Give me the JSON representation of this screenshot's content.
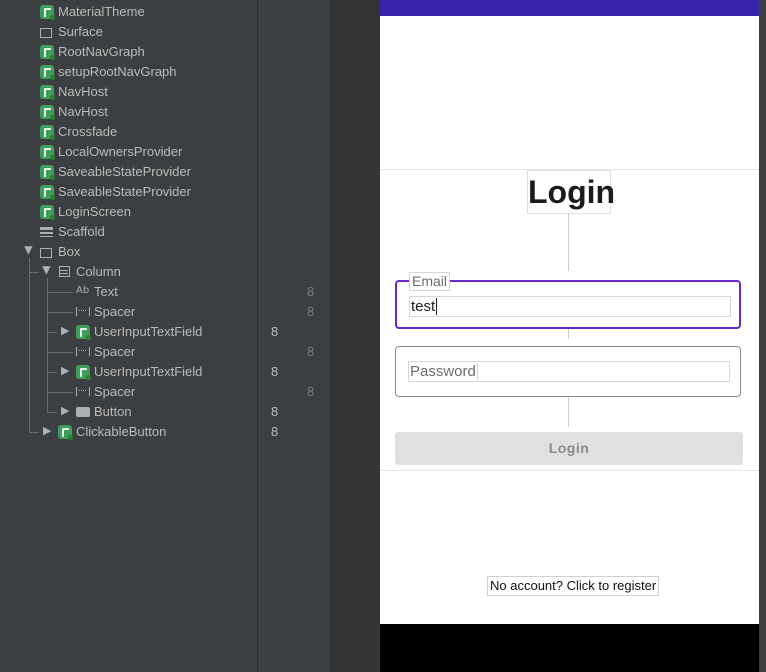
{
  "tree": {
    "rows": [
      {
        "label": "MaterialTheme",
        "icon": "compose-icon"
      },
      {
        "label": "Surface",
        "icon": "rect-icon"
      },
      {
        "label": "RootNavGraph",
        "icon": "compose-icon"
      },
      {
        "label": "setupRootNavGraph",
        "icon": "compose-icon"
      },
      {
        "label": "NavHost",
        "icon": "compose-icon"
      },
      {
        "label": "NavHost",
        "icon": "compose-icon"
      },
      {
        "label": "Crossfade",
        "icon": "compose-icon"
      },
      {
        "label": "LocalOwnersProvider",
        "icon": "compose-icon"
      },
      {
        "label": "SaveableStateProvider",
        "icon": "compose-icon"
      },
      {
        "label": "SaveableStateProvider",
        "icon": "compose-icon"
      },
      {
        "label": "LoginScreen",
        "icon": "compose-icon"
      },
      {
        "label": "Scaffold",
        "icon": "scaffold-icon"
      },
      {
        "label": "Box",
        "icon": "rect-icon"
      },
      {
        "label": "Column",
        "icon": "column-icon"
      },
      {
        "label": "Text",
        "icon": "text-icon",
        "count": "8"
      },
      {
        "label": "Spacer",
        "icon": "spacer-icon",
        "count": "8"
      },
      {
        "label": "UserInputTextField",
        "icon": "compose-icon",
        "count": "8"
      },
      {
        "label": "Spacer",
        "icon": "spacer-icon",
        "count": "8"
      },
      {
        "label": "UserInputTextField",
        "icon": "compose-icon",
        "count": "8"
      },
      {
        "label": "Spacer",
        "icon": "spacer-icon",
        "count": "8"
      },
      {
        "label": "Button",
        "icon": "button-icon",
        "count": "8"
      },
      {
        "label": "ClickableButton",
        "icon": "compose-icon",
        "count": "8"
      }
    ],
    "text_icon_glyph": "Ab"
  },
  "preview": {
    "title": "Login",
    "email_label": "Email",
    "email_value": "test",
    "password_placeholder": "Password",
    "login_button": "Login",
    "register_link": "No account? Click to register"
  },
  "colors": {
    "accent": "#6b28c9",
    "status_bar": "#3824a8",
    "tree_bg": "#3c3f41"
  }
}
